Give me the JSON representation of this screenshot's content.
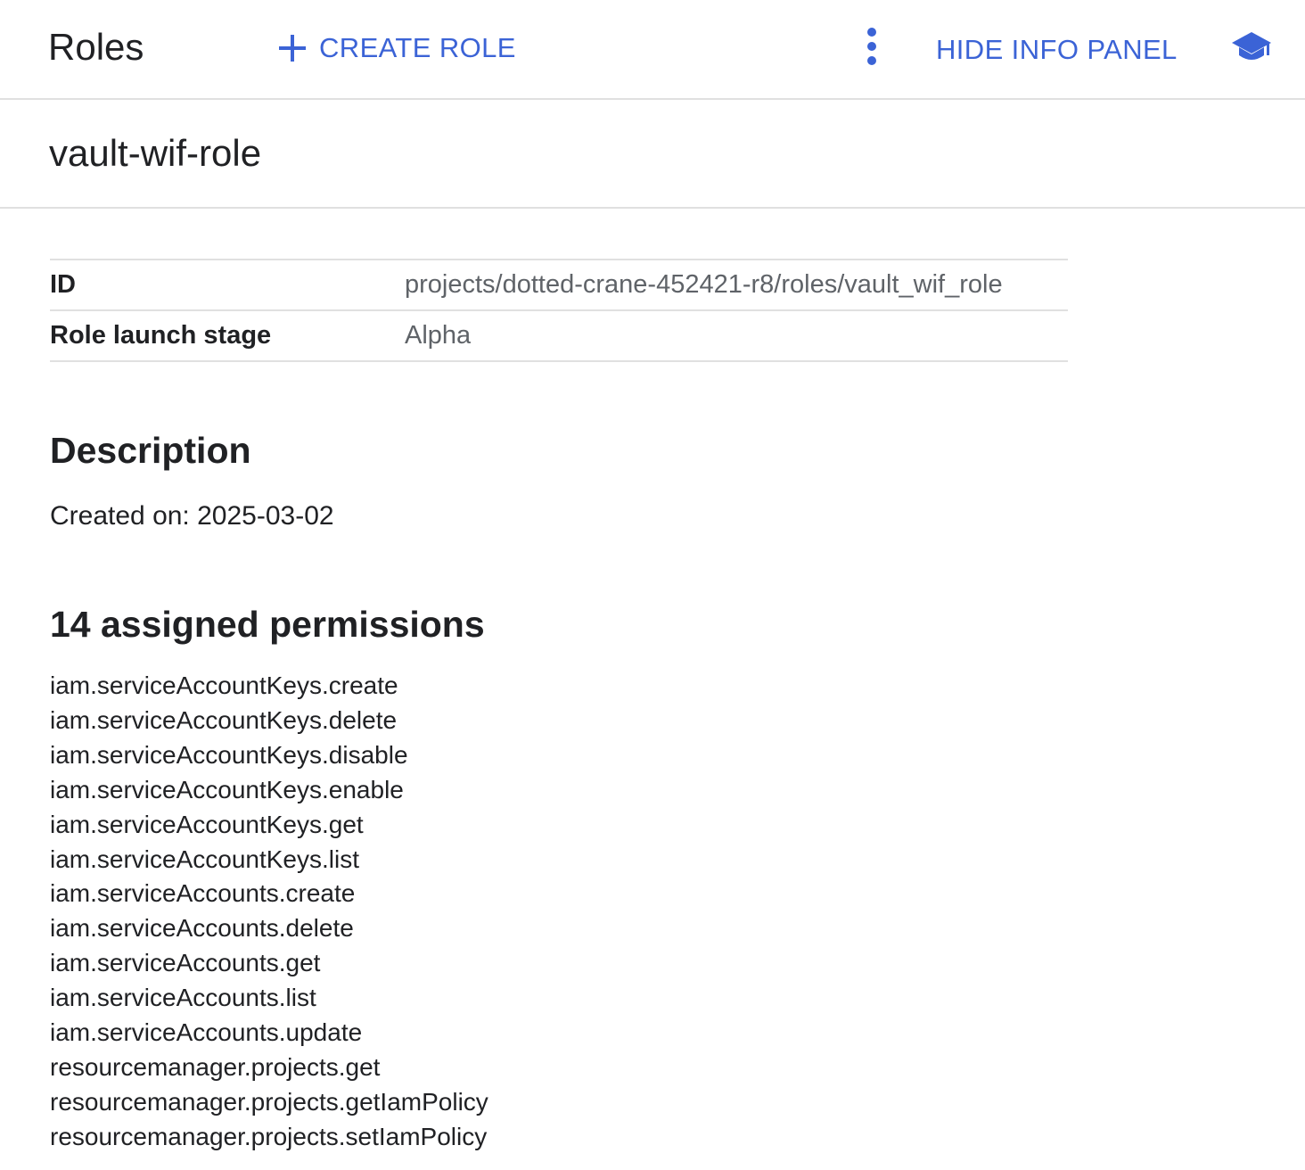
{
  "toolbar": {
    "title": "Roles",
    "create_role_label": "CREATE ROLE",
    "hide_info_label": "HIDE INFO PANEL",
    "icons": {
      "create": "plus-icon",
      "more": "more-vert-icon",
      "learn": "school-icon"
    }
  },
  "role": {
    "name": "vault-wif-role",
    "properties": [
      {
        "label": "ID",
        "value": "projects/dotted-crane-452421-r8/roles/vault_wif_role"
      },
      {
        "label": "Role launch stage",
        "value": "Alpha"
      }
    ]
  },
  "description": {
    "heading": "Description",
    "text": "Created on: 2025-03-02"
  },
  "permissions": {
    "heading": "14 assigned permissions",
    "count": 14,
    "items": [
      "iam.serviceAccountKeys.create",
      "iam.serviceAccountKeys.delete",
      "iam.serviceAccountKeys.disable",
      "iam.serviceAccountKeys.enable",
      "iam.serviceAccountKeys.get",
      "iam.serviceAccountKeys.list",
      "iam.serviceAccounts.create",
      "iam.serviceAccounts.delete",
      "iam.serviceAccounts.get",
      "iam.serviceAccounts.list",
      "iam.serviceAccounts.update",
      "resourcemanager.projects.get",
      "resourcemanager.projects.getIamPolicy",
      "resourcemanager.projects.setIamPolicy"
    ]
  },
  "colors": {
    "accent": "#3b63d6",
    "text": "#202124",
    "muted": "#5f6368",
    "divider": "#e0e0e0"
  }
}
